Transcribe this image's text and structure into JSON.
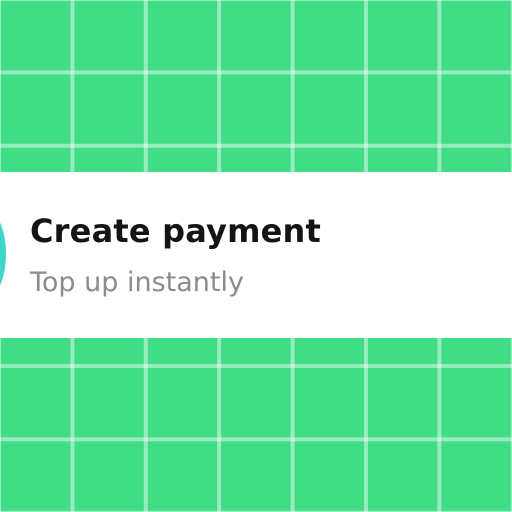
{
  "background": {
    "pattern": "grid",
    "color": "#41dc86",
    "line_color": "#a6efc6"
  },
  "card": {
    "icon": "circle-icon",
    "icon_color": "#3ed7c8",
    "title": "Create payment",
    "subtitle": "Top up instantly"
  }
}
